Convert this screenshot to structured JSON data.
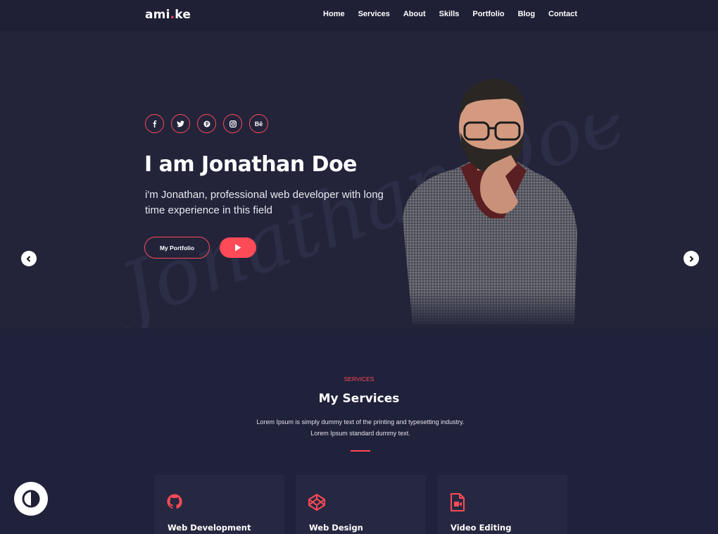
{
  "header": {
    "logo_main": "ami",
    "logo_dot": ".",
    "logo_end": "ke",
    "nav": [
      "Home",
      "Services",
      "About",
      "Skills",
      "Portfolio",
      "Blog",
      "Contact"
    ]
  },
  "hero": {
    "socials": [
      "facebook-icon",
      "twitter-icon",
      "pinterest-icon",
      "instagram-icon",
      "behance-icon"
    ],
    "behance_label": "Bē",
    "title": "I am Jonathan Doe",
    "description": "i'm Jonathan, professional web developer with long time experience in this field",
    "portfolio_button": "My Portfolio",
    "signature_text": "Jonathan Doe"
  },
  "services": {
    "eyebrow": "SERVICES",
    "title": "My Services",
    "description": "Lorem Ipsum is simply dummy text of the printing and typesetting industry. Lorem Ipsum standard dummy text.",
    "cards": [
      {
        "icon": "github-icon",
        "title": "Web Development"
      },
      {
        "icon": "codepen-icon",
        "title": "Web Design"
      },
      {
        "icon": "video-file-icon",
        "title": "Video Editing"
      }
    ]
  },
  "colors": {
    "accent": "#ff4a57",
    "background": "#22233a",
    "header": "#1f2035",
    "card": "#262841"
  }
}
